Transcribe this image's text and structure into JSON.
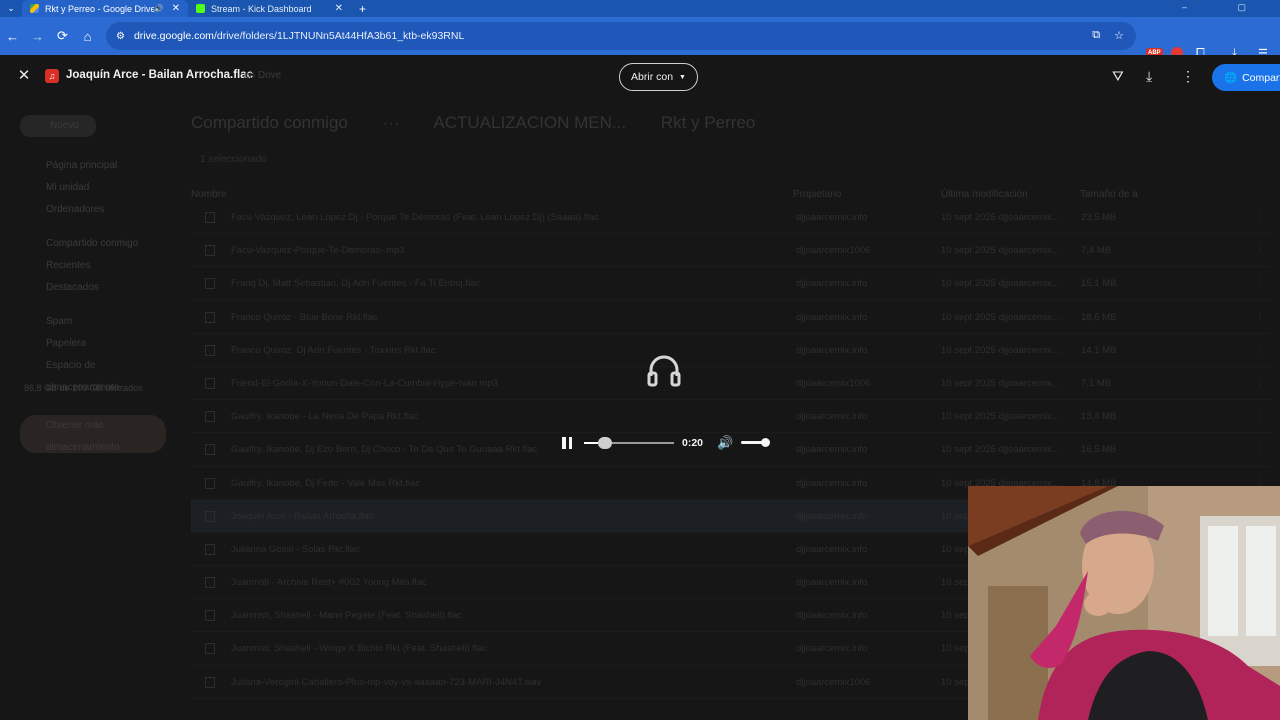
{
  "browser": {
    "tabs": [
      {
        "title": "Rkt y Perreo - Google Drive",
        "active": true,
        "favicon_color": "#34a853"
      },
      {
        "title": "Stream - Kick Dashboard",
        "active": false,
        "favicon_color": "#53fc18"
      }
    ],
    "url_domain": "drive.google.com",
    "url_path": "/drive/folders/1LJTNUNn5At44HfA3b61_ktb-ek93RNL",
    "abp_label": "ABP"
  },
  "drive": {
    "new_button": "Nuevo",
    "sidebar": [
      "Página principal",
      "Mi unidad",
      "Ordenadores",
      "Compartido conmigo",
      "Recientes",
      "Destacados",
      "Spam",
      "Papelera",
      "Espacio de almacenamiento"
    ],
    "storage_text": "86,8 GB de 100 GB utilizados",
    "storage_button": "Obtener más almacenamiento",
    "breadcrumbs": [
      "Compartido conmigo",
      "···",
      "ACTUALIZACION MEN...",
      "Rkt y Perreo"
    ],
    "selected_count": "1 seleccionado",
    "columns": {
      "name": "Nombre",
      "owner": "Propietario",
      "modified": "Última modificación",
      "size": "Tamaño de a"
    },
    "rows": [
      {
        "name": "Facu Vazquez, Lean Lopez Dj - Porque Te Demoras (Feat. Lean Lopez Dj) (Saaaa).flac",
        "owner": "djjoaarcemix.info",
        "date": "10 sept 2025 djjoaarcemix...",
        "size": "23,5 MB",
        "selected": false
      },
      {
        "name": "Facu-Vazquez-Porque-Te-Demoras-.mp3",
        "owner": "djjoaarcemix1006",
        "date": "10 sept 2025 djjoaarcemix...",
        "size": "7,4 MB",
        "selected": false
      },
      {
        "name": "Franq Dj, Matt Sebastian, Dj Adri Fuentes - Fa Ti Enboj.flac",
        "owner": "djjoaarcemix.info",
        "date": "10 sept 2025 djjoaarcemix...",
        "size": "15,1 MB",
        "selected": false
      },
      {
        "name": "Franco Quiroz - Blue Bone Rkt.flac",
        "owner": "djjoaarcemix.info",
        "date": "10 sept 2025 djjoaarcemix...",
        "size": "18,6 MB",
        "selected": false
      },
      {
        "name": "Franco Quiroz, Dj Adri Fuentes - Toxxins Rkt.flac",
        "owner": "djjoaarcemix.info",
        "date": "10 sept 2025 djjoaarcemix...",
        "size": "14,1 MB",
        "selected": false
      },
      {
        "name": "Friend-El-Gorila-X-Yonun-Dale-Con-La-Cumbia-Hype-Ivan.mp3",
        "owner": "djjoaarcemix1006",
        "date": "10 sept 2025 djjoaarcemix...",
        "size": "7,1 MB",
        "selected": false
      },
      {
        "name": "Gaulfry, Ikanobe - La Nena De Papa Rkt.flac",
        "owner": "djjoaarcemix.info",
        "date": "10 sept 2025 djjoaarcemix...",
        "size": "13,4 MB",
        "selected": false
      },
      {
        "name": "Gaulfry, Ikanobe, Dj Ezo Bern, Dj Choco - Te Da Que Te Guuaaa Rkt.flac",
        "owner": "djjoaarcemix.info",
        "date": "10 sept 2025 djjoaarcemix...",
        "size": "16,5 MB",
        "selected": false
      },
      {
        "name": "Gaulfry, Ikanobe, Dj Fedo - Vale Mas Rkt.flac",
        "owner": "djjoaarcemix.info",
        "date": "10 sept 2025 djjoaarcemix...",
        "size": "14,8 MB",
        "selected": false
      },
      {
        "name": "Joaquin Arce - Bailan Arrocha.flac",
        "owner": "djjoaarcemix.info",
        "date": "10 sept 2025",
        "size": "",
        "selected": true
      },
      {
        "name": "Julianna Gossi - Solas Rkt.flac",
        "owner": "djjoaarcemix.info",
        "date": "10 sept 2025",
        "size": "",
        "selected": false
      },
      {
        "name": "Juanmsti - Archive Rest+ #002 Young Milo.flac",
        "owner": "djjoaarcemix.info",
        "date": "10 sept 2025",
        "size": "",
        "selected": false
      },
      {
        "name": "Juanmsti, Shashell - Mami Pegate (Feat. Shashell).flac",
        "owner": "djjoaarcemix.info",
        "date": "10 sept 2025",
        "size": "",
        "selected": false
      },
      {
        "name": "Juanmsti, Shashell - Wings X Bichio Rkt (Feat. Shashell).flac",
        "owner": "djjoaarcemix.info",
        "date": "10 sept 2025",
        "size": "",
        "selected": false
      },
      {
        "name": "Juliana-Verogini-Caballero-Plus-mp-voy-vs-aaaaan-723-MARI-J4N4T.wav",
        "owner": "djjoaarcemix1006",
        "date": "10 sept 2025",
        "size": "",
        "selected": false
      }
    ]
  },
  "viewer": {
    "file_title": "Joaquín Arce - Bailan Arrocha.flac",
    "file_sub": "en Drive",
    "open_with": "Abrir con",
    "share_label": "Compart",
    "player": {
      "time": "0:20",
      "progress": 0.2,
      "volume": 1.0
    }
  },
  "colors": {
    "tabbar": "#1a56b0",
    "navbar": "#2c6bd4",
    "share": "#1a73e8",
    "file_icon": "#d93025"
  }
}
